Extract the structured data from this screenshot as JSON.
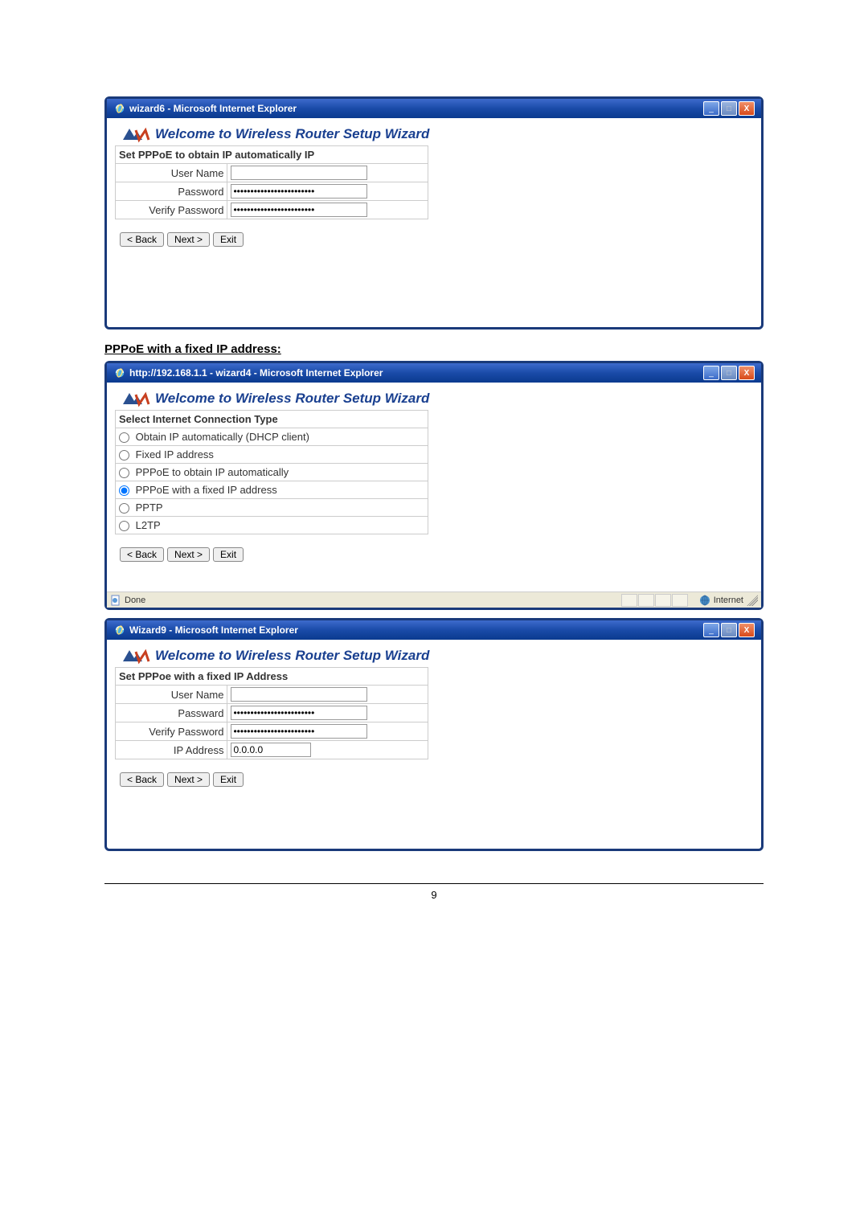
{
  "window1": {
    "title": "wizard6 - Microsoft Internet Explorer",
    "wizard_heading": "Welcome to Wireless Router Setup Wizard",
    "section_title": "Set PPPoE to obtain IP automatically IP",
    "labels": {
      "username": "User Name",
      "password": "Password",
      "verify_password": "Verify Password"
    },
    "values": {
      "username": "",
      "password": "••••••••••••••••••••••••",
      "verify_password": "••••••••••••••••••••••••"
    },
    "buttons": {
      "back": "< Back",
      "next": "Next >",
      "exit": "Exit"
    }
  },
  "section_heading": "PPPoE with a fixed IP address:",
  "window2": {
    "title": "http://192.168.1.1 - wizard4 - Microsoft Internet Explorer",
    "wizard_heading": "Welcome to Wireless Router Setup Wizard",
    "section_title": "Select Internet Connection Type",
    "options": [
      {
        "label": "Obtain IP automatically (DHCP client)",
        "selected": false
      },
      {
        "label": "Fixed IP address",
        "selected": false
      },
      {
        "label": "PPPoE to obtain IP automatically",
        "selected": false
      },
      {
        "label": "PPPoE with a fixed IP address",
        "selected": true
      },
      {
        "label": "PPTP",
        "selected": false
      },
      {
        "label": "L2TP",
        "selected": false
      }
    ],
    "buttons": {
      "back": "< Back",
      "next": "Next >",
      "exit": "Exit"
    },
    "status": {
      "done": "Done",
      "zone": "Internet"
    }
  },
  "window3": {
    "title": "Wizard9 - Microsoft Internet Explorer",
    "wizard_heading": "Welcome to Wireless Router Setup Wizard",
    "section_title": "Set PPPoe with a fixed IP Address",
    "labels": {
      "username": "User Name",
      "password": "Passward",
      "verify_password": "Verify Password",
      "ip_address": "IP Address"
    },
    "values": {
      "username": "",
      "password": "••••••••••••••••••••••••",
      "verify_password": "••••••••••••••••••••••••",
      "ip_address": "0.0.0.0"
    },
    "buttons": {
      "back": "< Back",
      "next": "Next >",
      "exit": "Exit"
    }
  },
  "page_number": "9"
}
